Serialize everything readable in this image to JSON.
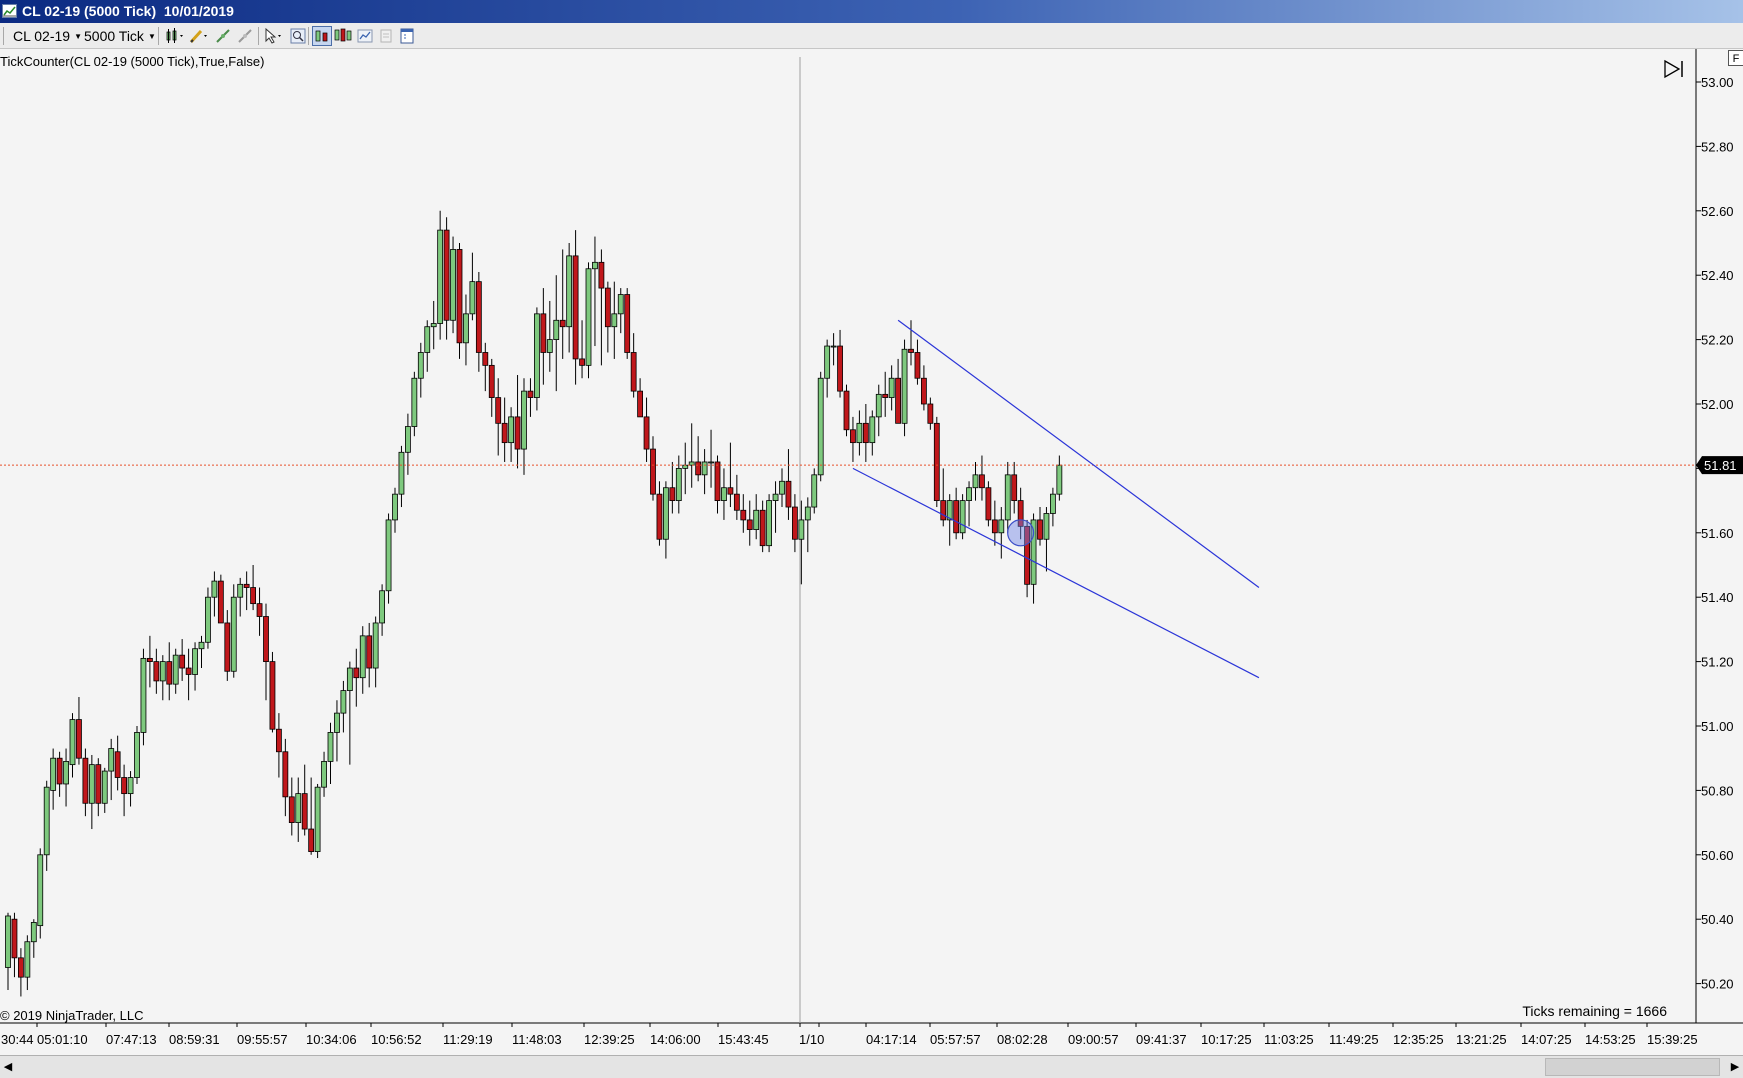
{
  "window": {
    "title": "CL 02-19 (5000 Tick)  10/01/2019"
  },
  "toolbar": {
    "instrument": "CL 02-19",
    "interval": "5000 Tick",
    "icons": [
      "bar-type-icon",
      "drawing-pencil-icon",
      "draw-tool-icon",
      "snap-tool-icon",
      "pointer-icon",
      "zoom-icon",
      "chart-type-icon",
      "multi-chart-icon",
      "strategy-icon",
      "data-box-icon",
      "properties-icon"
    ]
  },
  "indicator_label": "TickCounter(CL 02-19 (5000 Tick),True,False)",
  "copyright": "© 2019 NinjaTrader, LLC",
  "ticks_remaining": "Ticks remaining = 1666",
  "panel_tab": "F",
  "colors": {
    "up_fill": "#7ec97e",
    "down_fill": "#c0171b",
    "outline": "#000000",
    "trendline": "#2b35d8",
    "price_line": "#e6502a",
    "price_marker_bg": "#000000",
    "divider": "#a0a0a0"
  },
  "chart_data": {
    "type": "candlestick",
    "y_axis": {
      "min": 50.16,
      "max": 53.04,
      "ticks": [
        "53.00",
        "52.80",
        "52.60",
        "52.40",
        "52.20",
        "52.00",
        "51.80",
        "51.60",
        "51.40",
        "51.20",
        "51.00",
        "50.80",
        "50.60",
        "50.40",
        "50.20"
      ]
    },
    "x_axis_labels": [
      "30:44",
      "05:01:10",
      "07:47:13",
      "08:59:31",
      "09:55:57",
      "10:34:06",
      "10:56:52",
      "11:29:19",
      "11:48:03",
      "12:39:25",
      "14:06:00",
      "15:43:45",
      "1/10",
      "04:17:14",
      "05:57:57",
      "08:02:28",
      "09:00:57",
      "09:41:37",
      "10:17:25",
      "11:03:25",
      "11:49:25",
      "12:35:25",
      "13:21:25",
      "14:07:25",
      "14:53:25",
      "15:39:25"
    ],
    "last_price": "51.81",
    "session_break_label": "1/10",
    "candles": [
      [
        50.25,
        50.42,
        50.18,
        50.41
      ],
      [
        50.4,
        50.42,
        50.22,
        50.28
      ],
      [
        50.28,
        50.31,
        50.16,
        50.22
      ],
      [
        50.22,
        50.35,
        50.18,
        50.33
      ],
      [
        50.33,
        50.4,
        50.28,
        50.39
      ],
      [
        50.38,
        50.62,
        50.34,
        50.6
      ],
      [
        50.6,
        50.83,
        50.55,
        50.81
      ],
      [
        50.8,
        50.93,
        50.74,
        50.9
      ],
      [
        50.9,
        50.92,
        50.78,
        50.82
      ],
      [
        50.82,
        50.93,
        50.75,
        50.89
      ],
      [
        50.88,
        51.04,
        50.84,
        51.02
      ],
      [
        51.02,
        51.09,
        50.88,
        50.9
      ],
      [
        50.9,
        50.93,
        50.72,
        50.76
      ],
      [
        50.76,
        50.91,
        50.68,
        50.88
      ],
      [
        50.88,
        50.9,
        50.72,
        50.76
      ],
      [
        50.76,
        50.87,
        50.73,
        50.86
      ],
      [
        50.86,
        50.96,
        50.77,
        50.93
      ],
      [
        50.92,
        50.97,
        50.8,
        50.84
      ],
      [
        50.84,
        50.88,
        50.72,
        50.79
      ],
      [
        50.79,
        50.86,
        50.75,
        50.84
      ],
      [
        50.84,
        51.0,
        50.82,
        50.98
      ],
      [
        50.98,
        51.24,
        50.94,
        51.21
      ],
      [
        51.21,
        51.28,
        51.12,
        51.2
      ],
      [
        51.2,
        51.24,
        51.1,
        51.14
      ],
      [
        51.14,
        51.22,
        51.08,
        51.2
      ],
      [
        51.2,
        51.26,
        51.08,
        51.13
      ],
      [
        51.13,
        51.24,
        51.1,
        51.22
      ],
      [
        51.22,
        51.27,
        51.14,
        51.18
      ],
      [
        51.18,
        51.24,
        51.08,
        51.16
      ],
      [
        51.16,
        51.26,
        51.11,
        51.24
      ],
      [
        51.24,
        51.28,
        51.18,
        51.26
      ],
      [
        51.26,
        51.43,
        51.24,
        51.4
      ],
      [
        51.4,
        51.48,
        51.34,
        51.45
      ],
      [
        51.45,
        51.47,
        51.32,
        51.32
      ],
      [
        51.32,
        51.36,
        51.14,
        51.17
      ],
      [
        51.17,
        51.44,
        51.15,
        51.4
      ],
      [
        51.4,
        51.46,
        51.34,
        51.44
      ],
      [
        51.44,
        51.48,
        51.36,
        51.43
      ],
      [
        51.43,
        51.5,
        51.36,
        51.38
      ],
      [
        51.38,
        51.43,
        51.28,
        51.34
      ],
      [
        51.34,
        51.38,
        51.08,
        51.2
      ],
      [
        51.2,
        51.23,
        50.98,
        50.99
      ],
      [
        50.99,
        51.04,
        50.84,
        50.92
      ],
      [
        50.92,
        50.96,
        50.72,
        50.78
      ],
      [
        50.78,
        50.84,
        50.66,
        50.7
      ],
      [
        50.7,
        50.84,
        50.64,
        50.79
      ],
      [
        50.79,
        50.88,
        50.66,
        50.68
      ],
      [
        50.68,
        50.84,
        50.6,
        50.61
      ],
      [
        50.61,
        50.82,
        50.59,
        50.81
      ],
      [
        50.81,
        50.92,
        50.78,
        50.89
      ],
      [
        50.89,
        51.01,
        50.82,
        50.98
      ],
      [
        50.98,
        51.08,
        50.89,
        51.04
      ],
      [
        51.04,
        51.14,
        50.98,
        51.11
      ],
      [
        51.11,
        51.2,
        50.88,
        51.18
      ],
      [
        51.18,
        51.24,
        51.06,
        51.15
      ],
      [
        51.15,
        51.31,
        51.1,
        51.28
      ],
      [
        51.28,
        51.32,
        51.12,
        51.18
      ],
      [
        51.18,
        51.34,
        51.12,
        51.32
      ],
      [
        51.32,
        51.44,
        51.28,
        51.42
      ],
      [
        51.42,
        51.66,
        51.38,
        51.64
      ],
      [
        51.64,
        51.74,
        51.6,
        51.72
      ],
      [
        51.72,
        51.87,
        51.68,
        51.85
      ],
      [
        51.85,
        51.97,
        51.78,
        51.93
      ],
      [
        51.93,
        52.1,
        51.9,
        52.08
      ],
      [
        52.08,
        52.19,
        52.02,
        52.16
      ],
      [
        52.16,
        52.26,
        52.1,
        52.24
      ],
      [
        52.24,
        52.32,
        52.17,
        52.25
      ],
      [
        52.25,
        52.6,
        52.2,
        52.54
      ],
      [
        52.54,
        52.58,
        52.2,
        52.26
      ],
      [
        52.26,
        52.52,
        52.22,
        52.48
      ],
      [
        52.48,
        52.5,
        52.14,
        52.19
      ],
      [
        52.19,
        52.34,
        52.12,
        52.28
      ],
      [
        52.28,
        52.47,
        52.26,
        52.38
      ],
      [
        52.38,
        52.41,
        52.1,
        52.16
      ],
      [
        52.16,
        52.19,
        52.04,
        52.12
      ],
      [
        52.12,
        52.14,
        51.96,
        52.02
      ],
      [
        52.02,
        52.08,
        51.84,
        51.94
      ],
      [
        51.94,
        52.02,
        51.82,
        51.88
      ],
      [
        51.88,
        51.99,
        51.82,
        51.96
      ],
      [
        51.96,
        52.09,
        51.8,
        51.86
      ],
      [
        51.86,
        52.08,
        51.78,
        52.04
      ],
      [
        52.04,
        52.08,
        51.96,
        52.02
      ],
      [
        52.02,
        52.3,
        51.98,
        52.28
      ],
      [
        52.28,
        52.36,
        52.06,
        52.16
      ],
      [
        52.16,
        52.32,
        52.1,
        52.2
      ],
      [
        52.2,
        52.4,
        52.04,
        52.26
      ],
      [
        52.26,
        52.48,
        52.14,
        52.24
      ],
      [
        52.24,
        52.5,
        52.16,
        52.46
      ],
      [
        52.46,
        52.54,
        52.06,
        52.14
      ],
      [
        52.14,
        52.26,
        52.08,
        52.12
      ],
      [
        52.12,
        52.44,
        52.08,
        52.42
      ],
      [
        52.42,
        52.52,
        52.18,
        52.44
      ],
      [
        52.44,
        52.48,
        52.12,
        52.36
      ],
      [
        52.36,
        52.38,
        52.16,
        52.24
      ],
      [
        52.24,
        52.38,
        52.14,
        52.28
      ],
      [
        52.28,
        52.36,
        52.22,
        52.34
      ],
      [
        52.34,
        52.36,
        52.14,
        52.16
      ],
      [
        52.16,
        52.22,
        52.02,
        52.04
      ],
      [
        52.04,
        52.08,
        51.96,
        51.96
      ],
      [
        51.96,
        52.02,
        51.82,
        51.86
      ],
      [
        51.86,
        51.9,
        51.7,
        51.72
      ],
      [
        51.72,
        51.76,
        51.56,
        51.58
      ],
      [
        51.58,
        51.76,
        51.52,
        51.74
      ],
      [
        51.74,
        51.82,
        51.66,
        51.7
      ],
      [
        51.7,
        51.84,
        51.66,
        51.8
      ],
      [
        51.8,
        51.88,
        51.72,
        51.81
      ],
      [
        51.81,
        51.94,
        51.74,
        51.82
      ],
      [
        51.82,
        51.9,
        51.76,
        51.78
      ],
      [
        51.78,
        51.86,
        51.72,
        51.82
      ],
      [
        51.82,
        51.92,
        51.74,
        51.82
      ],
      [
        51.82,
        51.84,
        51.66,
        51.7
      ],
      [
        51.7,
        51.8,
        51.64,
        51.74
      ],
      [
        51.74,
        51.88,
        51.68,
        51.72
      ],
      [
        51.72,
        51.78,
        51.64,
        51.67
      ],
      [
        51.67,
        51.72,
        51.6,
        51.64
      ],
      [
        51.64,
        51.7,
        51.56,
        51.61
      ],
      [
        51.61,
        51.72,
        51.58,
        51.67
      ],
      [
        51.67,
        51.7,
        51.54,
        51.56
      ],
      [
        51.56,
        51.72,
        51.54,
        51.7
      ],
      [
        51.7,
        51.76,
        51.6,
        51.72
      ],
      [
        51.72,
        51.8,
        51.68,
        51.76
      ],
      [
        51.76,
        51.86,
        51.64,
        51.68
      ],
      [
        51.68,
        51.72,
        51.54,
        51.58
      ],
      [
        51.58,
        51.7,
        51.44,
        51.64
      ],
      [
        51.64,
        51.71,
        51.54,
        51.68
      ],
      [
        51.68,
        51.8,
        51.66,
        51.78
      ],
      [
        51.78,
        52.1,
        51.76,
        52.08
      ],
      [
        52.08,
        52.2,
        52.02,
        52.18
      ],
      [
        52.18,
        52.22,
        52.12,
        52.18
      ],
      [
        52.18,
        52.23,
        52.02,
        52.04
      ],
      [
        52.04,
        52.06,
        51.9,
        51.92
      ],
      [
        51.92,
        51.96,
        51.82,
        51.88
      ],
      [
        51.88,
        51.98,
        51.84,
        51.94
      ],
      [
        51.94,
        52.0,
        51.82,
        51.88
      ],
      [
        51.88,
        51.98,
        51.84,
        51.96
      ],
      [
        51.96,
        52.06,
        51.9,
        52.03
      ],
      [
        52.03,
        52.1,
        51.96,
        52.02
      ],
      [
        52.02,
        52.12,
        51.98,
        52.08
      ],
      [
        52.08,
        52.14,
        51.94,
        51.94
      ],
      [
        51.94,
        52.2,
        51.9,
        52.17
      ],
      [
        52.17,
        52.26,
        52.12,
        52.16
      ],
      [
        52.16,
        52.2,
        52.06,
        52.08
      ],
      [
        52.08,
        52.12,
        51.98,
        52.0
      ],
      [
        52.0,
        52.02,
        51.92,
        51.94
      ],
      [
        51.94,
        51.96,
        51.68,
        51.7
      ],
      [
        51.7,
        51.8,
        51.62,
        51.64
      ],
      [
        51.64,
        51.72,
        51.56,
        51.7
      ],
      [
        51.7,
        51.74,
        51.58,
        51.6
      ],
      [
        51.6,
        51.72,
        51.58,
        51.7
      ],
      [
        51.7,
        51.76,
        51.62,
        51.74
      ],
      [
        51.74,
        51.82,
        51.7,
        51.78
      ],
      [
        51.78,
        51.84,
        51.7,
        51.74
      ],
      [
        51.74,
        51.76,
        51.62,
        51.64
      ],
      [
        51.64,
        51.7,
        51.56,
        51.6
      ],
      [
        51.6,
        51.68,
        51.52,
        51.64
      ],
      [
        51.64,
        51.82,
        51.6,
        51.78
      ],
      [
        51.78,
        51.82,
        51.66,
        51.7
      ],
      [
        51.7,
        51.74,
        51.58,
        51.62
      ],
      [
        51.62,
        51.64,
        51.4,
        51.44
      ],
      [
        51.44,
        51.66,
        51.38,
        51.64
      ],
      [
        51.64,
        51.68,
        51.56,
        51.58
      ],
      [
        51.58,
        51.68,
        51.48,
        51.66
      ],
      [
        51.66,
        51.74,
        51.62,
        51.72
      ],
      [
        51.72,
        51.84,
        51.7,
        51.81
      ]
    ],
    "trend_lines": [
      {
        "from": {
          "bar": 131,
          "price": 51.8
        },
        "to": {
          "bar": 171,
          "price": 51.15
        }
      },
      {
        "from": {
          "bar": 138,
          "price": 52.26
        },
        "to": {
          "bar": 171,
          "price": 51.43
        }
      }
    ],
    "marker_circle": {
      "bar": 157,
      "price": 51.6
    }
  }
}
